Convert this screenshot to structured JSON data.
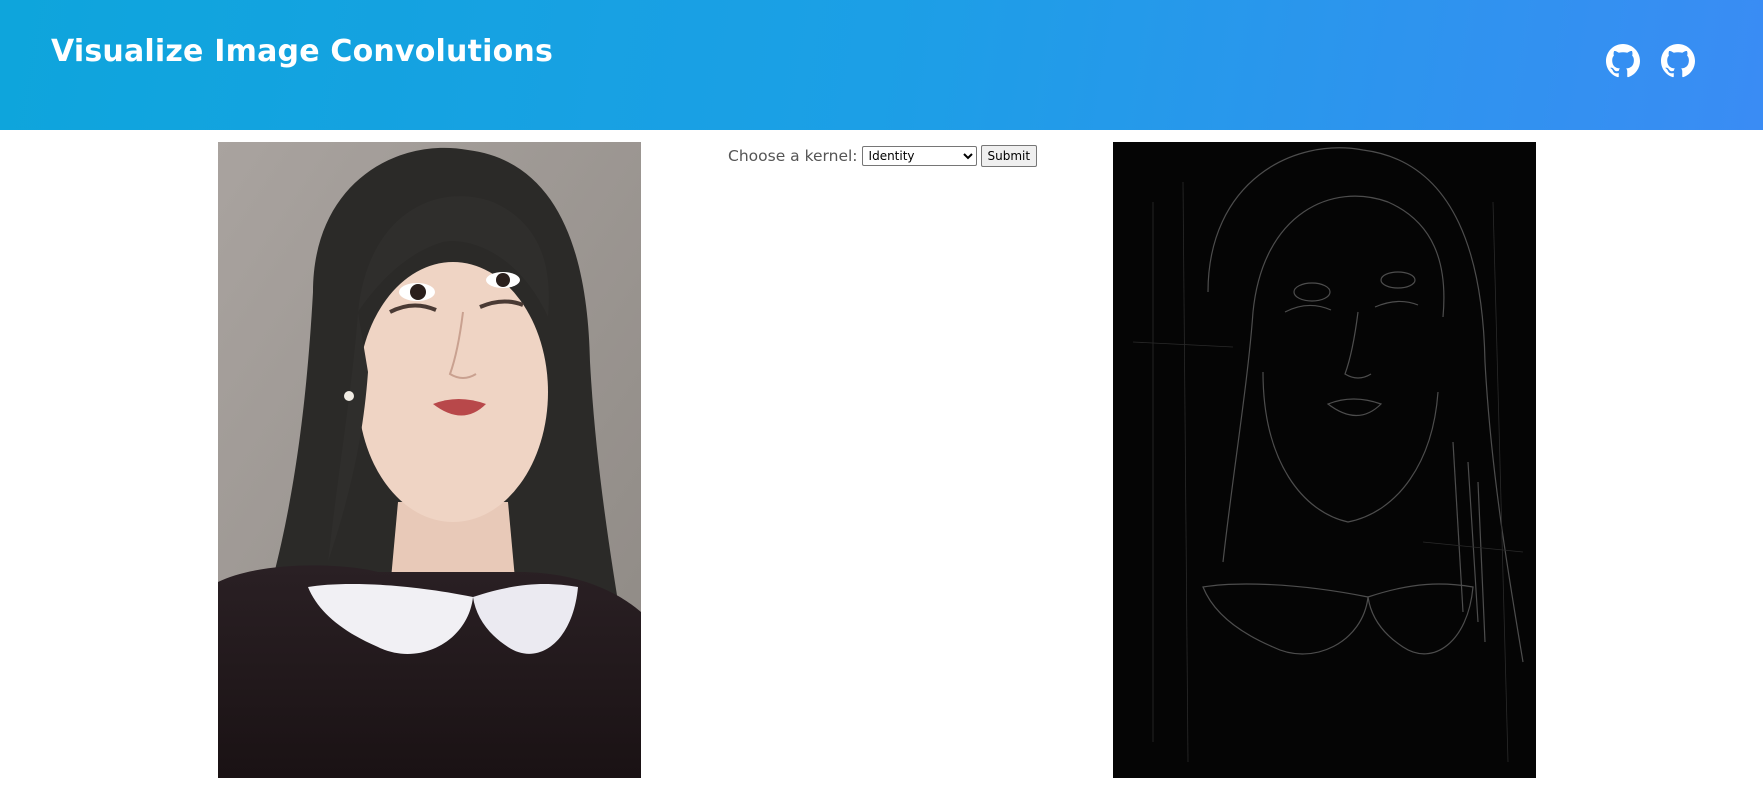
{
  "header": {
    "title": "Visualize Image Convolutions",
    "links": [
      {
        "icon": "github-icon"
      },
      {
        "icon": "github-icon"
      }
    ],
    "colors": {
      "gradient_start": "#0ea5dc",
      "gradient_end": "#3a8cf4",
      "text": "#ffffff"
    }
  },
  "controls": {
    "kernel_label": "Choose a kernel:",
    "kernel_selected": "Identity",
    "submit_label": "Submit"
  },
  "images": {
    "original": {
      "icon": "portrait-photo"
    },
    "convolved": {
      "icon": "edge-detected-portrait"
    }
  }
}
